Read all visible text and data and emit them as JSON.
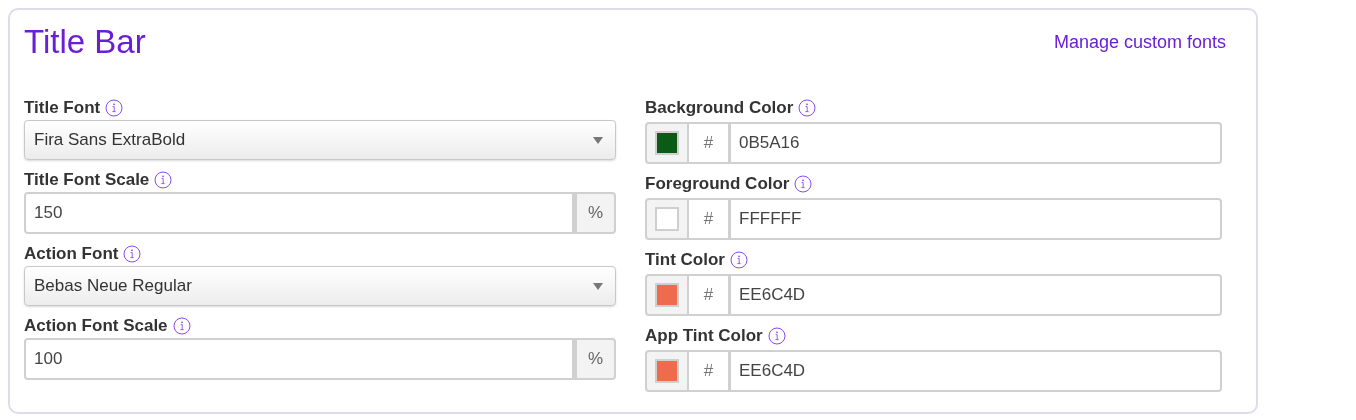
{
  "section": {
    "title": "Title Bar",
    "link": "Manage custom fonts"
  },
  "left_fields": [
    {
      "label": "Title Font",
      "kind": "select",
      "value": "Fira Sans ExtraBold"
    },
    {
      "label": "Title Font Scale",
      "kind": "number",
      "value": "150",
      "unit": "%"
    },
    {
      "label": "Action Font",
      "kind": "select",
      "value": "Bebas Neue Regular"
    },
    {
      "label": "Action Font Scale",
      "kind": "number",
      "value": "100",
      "unit": "%"
    }
  ],
  "color_fields": [
    {
      "label": "Background Color",
      "prefix": "#",
      "value": "0B5A16",
      "color": "#0b5a16"
    },
    {
      "label": "Foreground Color",
      "prefix": "#",
      "value": "FFFFFF",
      "color": "#ffffff"
    },
    {
      "label": "Tint Color",
      "prefix": "#",
      "value": "EE6C4D",
      "color": "#ee6c4d"
    },
    {
      "label": "App Tint Color",
      "prefix": "#",
      "value": "EE6C4D",
      "color": "#ee6c4d"
    }
  ]
}
